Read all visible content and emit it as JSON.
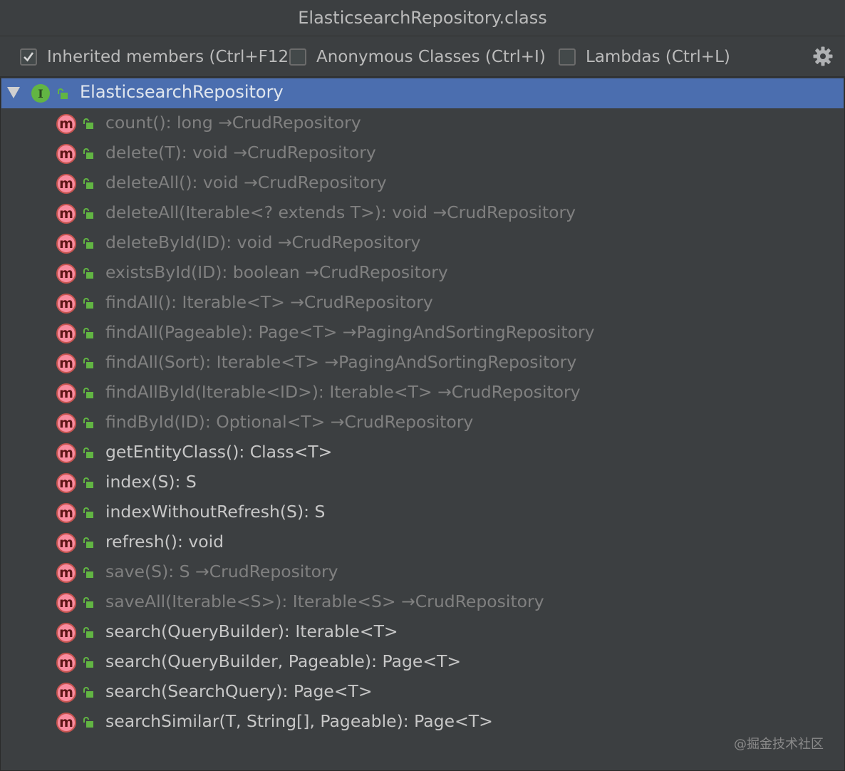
{
  "window": {
    "title": "ElasticsearchRepository.class"
  },
  "toolbar": {
    "options": [
      {
        "label": "Inherited members (Ctrl+F12)",
        "checked": true
      },
      {
        "label": "Anonymous Classes (Ctrl+I)",
        "checked": false
      },
      {
        "label": "Lambdas (Ctrl+L)",
        "checked": false
      }
    ],
    "settings_icon": "gear-icon"
  },
  "tree": {
    "root": {
      "label": "ElasticsearchRepository",
      "icon": "interface-icon",
      "badge": "I"
    },
    "method_badge": "m",
    "members": [
      {
        "label": "count(): long →CrudRepository",
        "inherited": true
      },
      {
        "label": "delete(T): void →CrudRepository",
        "inherited": true
      },
      {
        "label": "deleteAll(): void →CrudRepository",
        "inherited": true
      },
      {
        "label": "deleteAll(Iterable<? extends T>): void →CrudRepository",
        "inherited": true
      },
      {
        "label": "deleteById(ID): void →CrudRepository",
        "inherited": true
      },
      {
        "label": "existsById(ID): boolean →CrudRepository",
        "inherited": true
      },
      {
        "label": "findAll(): Iterable<T> →CrudRepository",
        "inherited": true
      },
      {
        "label": "findAll(Pageable): Page<T> →PagingAndSortingRepository",
        "inherited": true
      },
      {
        "label": "findAll(Sort): Iterable<T> →PagingAndSortingRepository",
        "inherited": true
      },
      {
        "label": "findAllById(Iterable<ID>): Iterable<T> →CrudRepository",
        "inherited": true
      },
      {
        "label": "findById(ID): Optional<T> →CrudRepository",
        "inherited": true
      },
      {
        "label": "getEntityClass(): Class<T>",
        "inherited": false
      },
      {
        "label": "index(S): S",
        "inherited": false
      },
      {
        "label": "indexWithoutRefresh(S): S",
        "inherited": false
      },
      {
        "label": "refresh(): void",
        "inherited": false
      },
      {
        "label": "save(S): S →CrudRepository",
        "inherited": true
      },
      {
        "label": "saveAll(Iterable<S>): Iterable<S> →CrudRepository",
        "inherited": true
      },
      {
        "label": "search(QueryBuilder): Iterable<T>",
        "inherited": false
      },
      {
        "label": "search(QueryBuilder, Pageable): Page<T>",
        "inherited": false
      },
      {
        "label": "search(SearchQuery): Page<T>",
        "inherited": false
      },
      {
        "label": "searchSimilar(T, String[], Pageable): Page<T>",
        "inherited": false
      }
    ]
  },
  "colors": {
    "background": "#3c3f41",
    "selection": "#4b6eaf",
    "inherited_text": "#808080",
    "own_text": "#c7c7c7",
    "method_icon": "#f98b9e",
    "interface_icon": "#62b543",
    "lock": "#62b543"
  },
  "watermark": "@掘金技术社区"
}
